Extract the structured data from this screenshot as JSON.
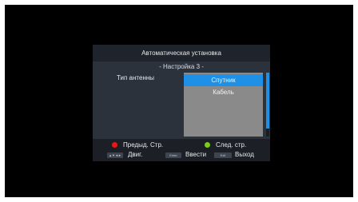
{
  "dialog": {
    "title": "Автоматическая установка",
    "subtitle": "- Настройка 3 -",
    "field_label": "Тип антенны",
    "options": [
      {
        "label": "Спутник",
        "selected": true
      },
      {
        "label": "Кабель",
        "selected": false
      }
    ]
  },
  "legend": {
    "red_label": "Предыд. Стр.",
    "green_label": "След. стр.",
    "move_keys": "▲▼◄►",
    "move_label": "Двиг.",
    "enter_key": "Enter",
    "enter_label": "Ввести",
    "exit_key": "Exit",
    "exit_label": "Выход"
  },
  "colors": {
    "red": "#e81818",
    "green": "#7ccc1c",
    "accent": "#1e90e6"
  }
}
